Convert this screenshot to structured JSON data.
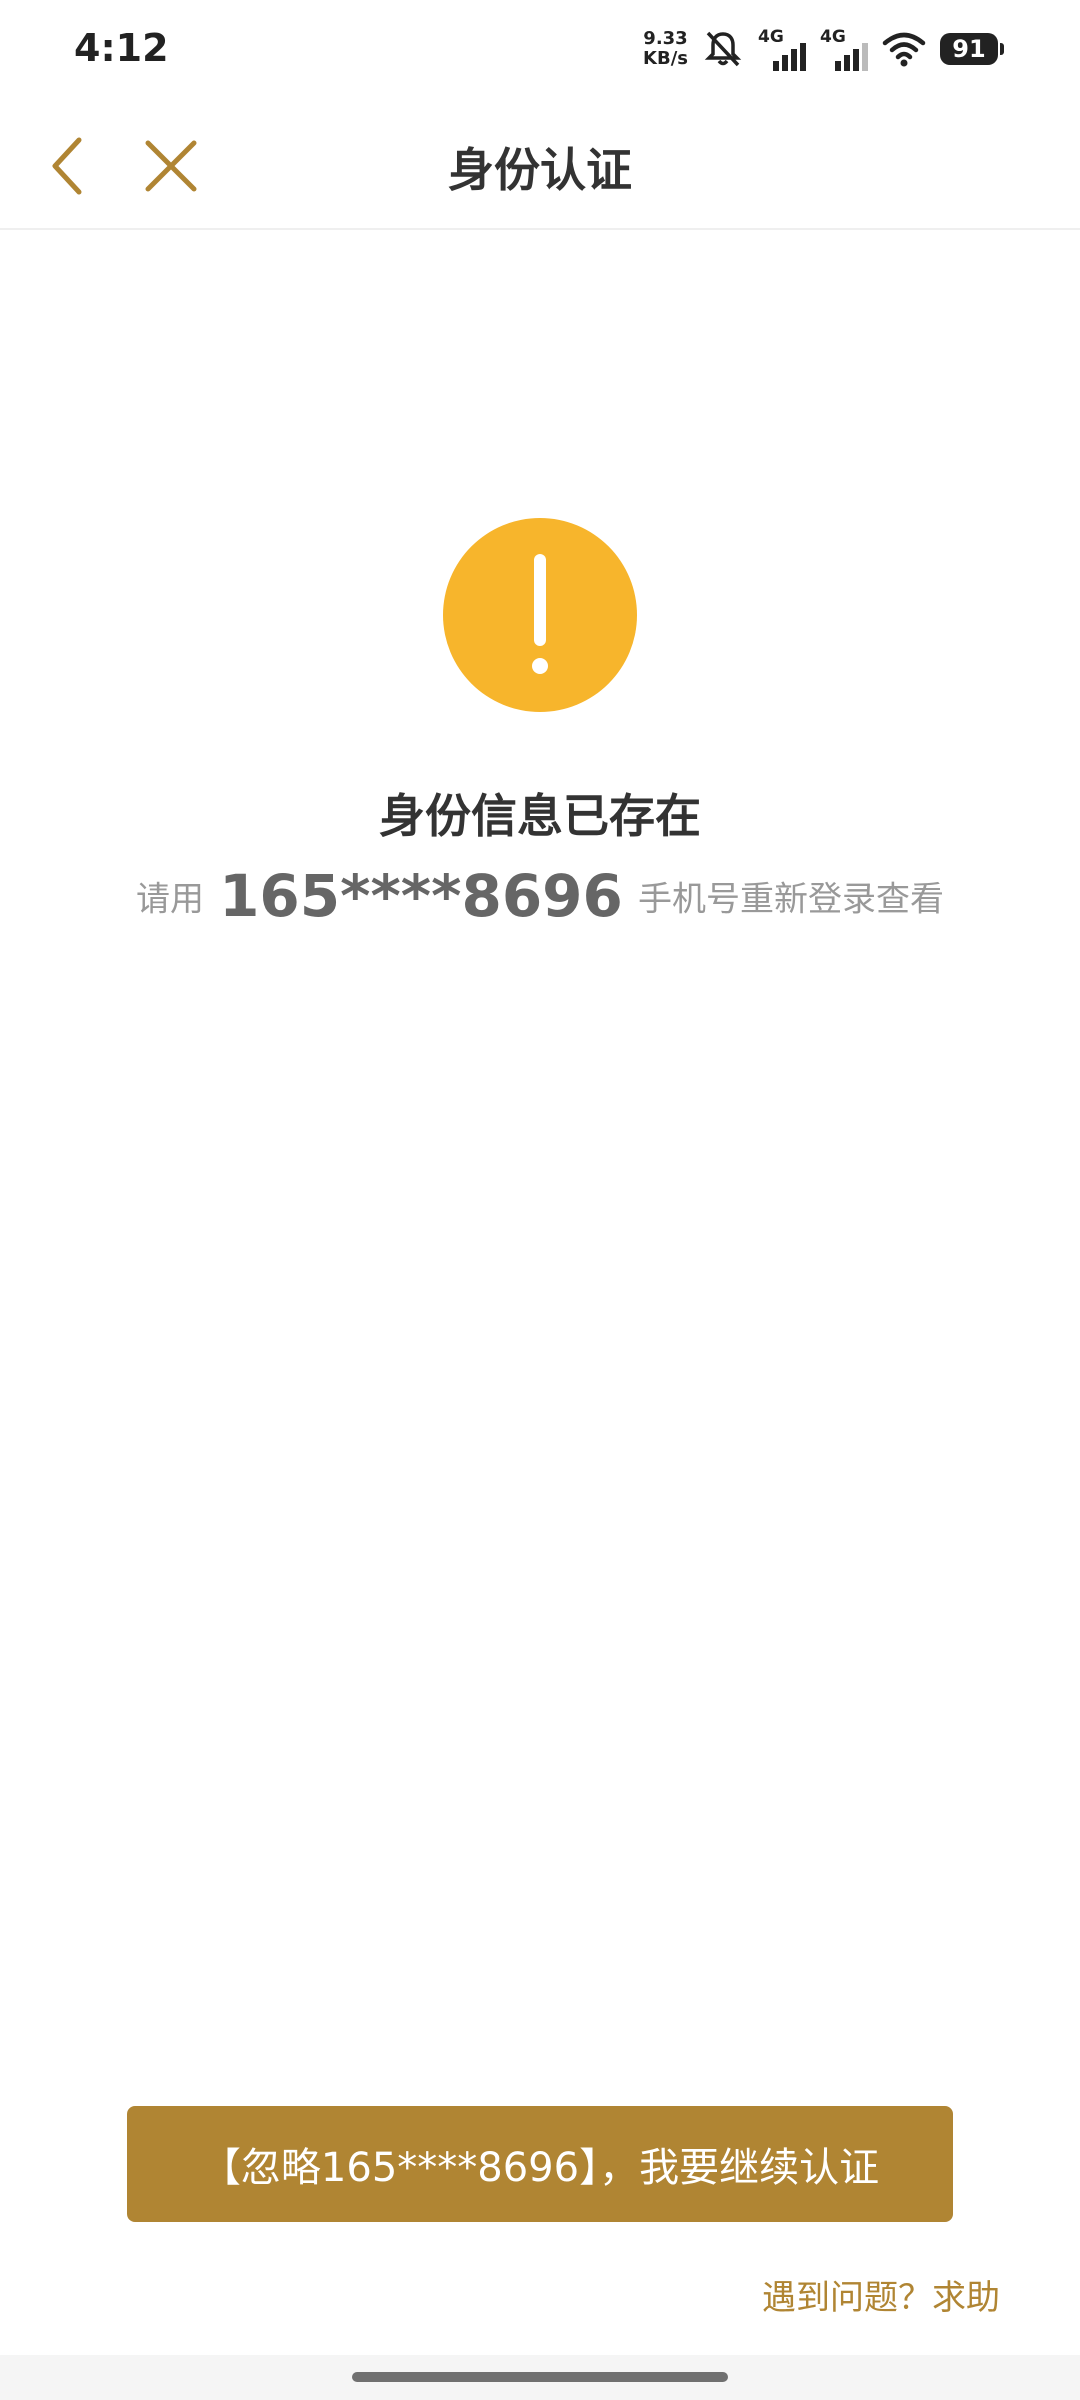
{
  "status_bar": {
    "time": "4:12",
    "net_speed_value": "9.33",
    "net_speed_unit": "KB/s",
    "sim1_tag": "4G",
    "sim2_tag": "4G",
    "battery_level": "91",
    "icons": [
      "bell-muted-icon",
      "signal-icon",
      "signal-icon",
      "wifi-icon",
      "battery-icon"
    ]
  },
  "nav": {
    "title": "身份认证",
    "back_icon": "chevron-left-icon",
    "close_icon": "close-icon",
    "accent_color": "#b08533"
  },
  "result": {
    "icon": "exclamation-icon",
    "icon_color": "#f7b52c",
    "title": "身份信息已存在",
    "desc_prefix": "请用",
    "phone": "165****8696",
    "desc_suffix": "手机号重新登录查看"
  },
  "actions": {
    "continue_label": "【忽略165****8696】，我要继续认证",
    "help_label": "遇到问题？求助",
    "button_color": "#b08533"
  }
}
